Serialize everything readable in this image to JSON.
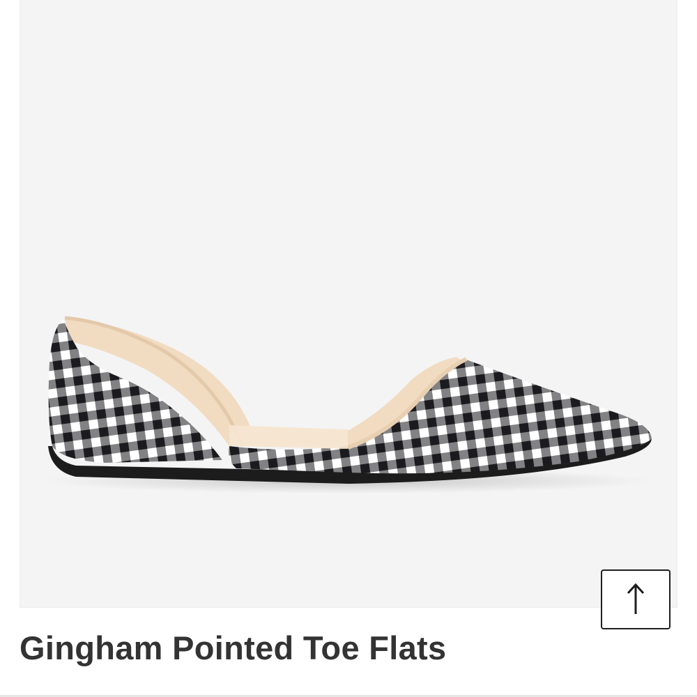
{
  "product": {
    "title": "Gingham Pointed Toe Flats",
    "image": {
      "subject": "shoe-image",
      "pattern": "gingham",
      "colors": {
        "background": "#f4f4f5",
        "check_dark": "#1b1b1f",
        "check_light": "#ffffff",
        "lining": "#f1dcc2",
        "sole": "#1c1c1c"
      }
    }
  },
  "scroll_top_button": {
    "icon": "arrow-up-icon",
    "glyph": "↑"
  },
  "colors": {
    "title": "#333333",
    "button_border": "#1e1e1e",
    "page_background": "#ffffff"
  }
}
